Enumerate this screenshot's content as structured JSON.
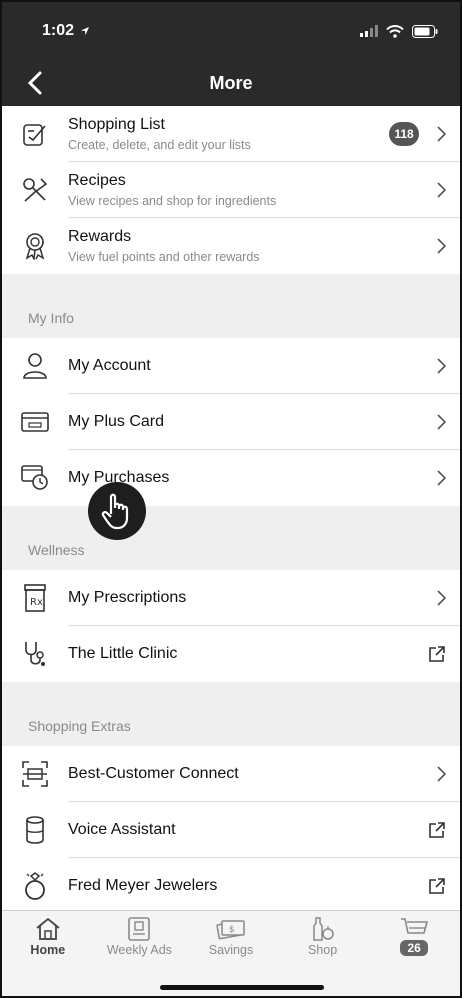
{
  "status": {
    "time": "1:02"
  },
  "header": {
    "title": "More"
  },
  "top_items": [
    {
      "label": "Shopping List",
      "sub": "Create, delete, and edit your lists",
      "badge": "118"
    },
    {
      "label": "Recipes",
      "sub": "View recipes and shop for ingredients"
    },
    {
      "label": "Rewards",
      "sub": "View fuel points and other rewards"
    }
  ],
  "sections": [
    {
      "title": "My Info",
      "items": [
        {
          "label": "My Account"
        },
        {
          "label": "My Plus Card"
        },
        {
          "label": "My Purchases"
        }
      ]
    },
    {
      "title": "Wellness",
      "items": [
        {
          "label": "My Prescriptions"
        },
        {
          "label": "The Little Clinic"
        }
      ]
    },
    {
      "title": "Shopping Extras",
      "items": [
        {
          "label": "Best-Customer Connect"
        },
        {
          "label": "Voice Assistant"
        },
        {
          "label": "Fred Meyer Jewelers"
        }
      ]
    }
  ],
  "tabbar": {
    "tabs": [
      {
        "label": "Home"
      },
      {
        "label": "Weekly Ads"
      },
      {
        "label": "Savings"
      },
      {
        "label": "Shop"
      }
    ],
    "cart_count": "26"
  },
  "icons": {
    "shopping_list": "edit-list-icon",
    "recipes": "utensils-icon",
    "rewards": "ribbon-icon",
    "account": "person-icon",
    "plus_card": "card-icon",
    "purchases": "receipt-clock-icon",
    "prescriptions": "rx-bottle-icon",
    "clinic": "stethoscope-icon",
    "connect": "scan-icon",
    "voice": "speaker-icon",
    "jewelers": "ring-icon",
    "chevron": "chevron-right-icon",
    "external": "external-link-icon",
    "cursor": "hand-pointer-icon"
  },
  "colors": {
    "header_bg": "#2a2a2a",
    "section_bg": "#efefef",
    "subtext": "#8a8a8a"
  }
}
